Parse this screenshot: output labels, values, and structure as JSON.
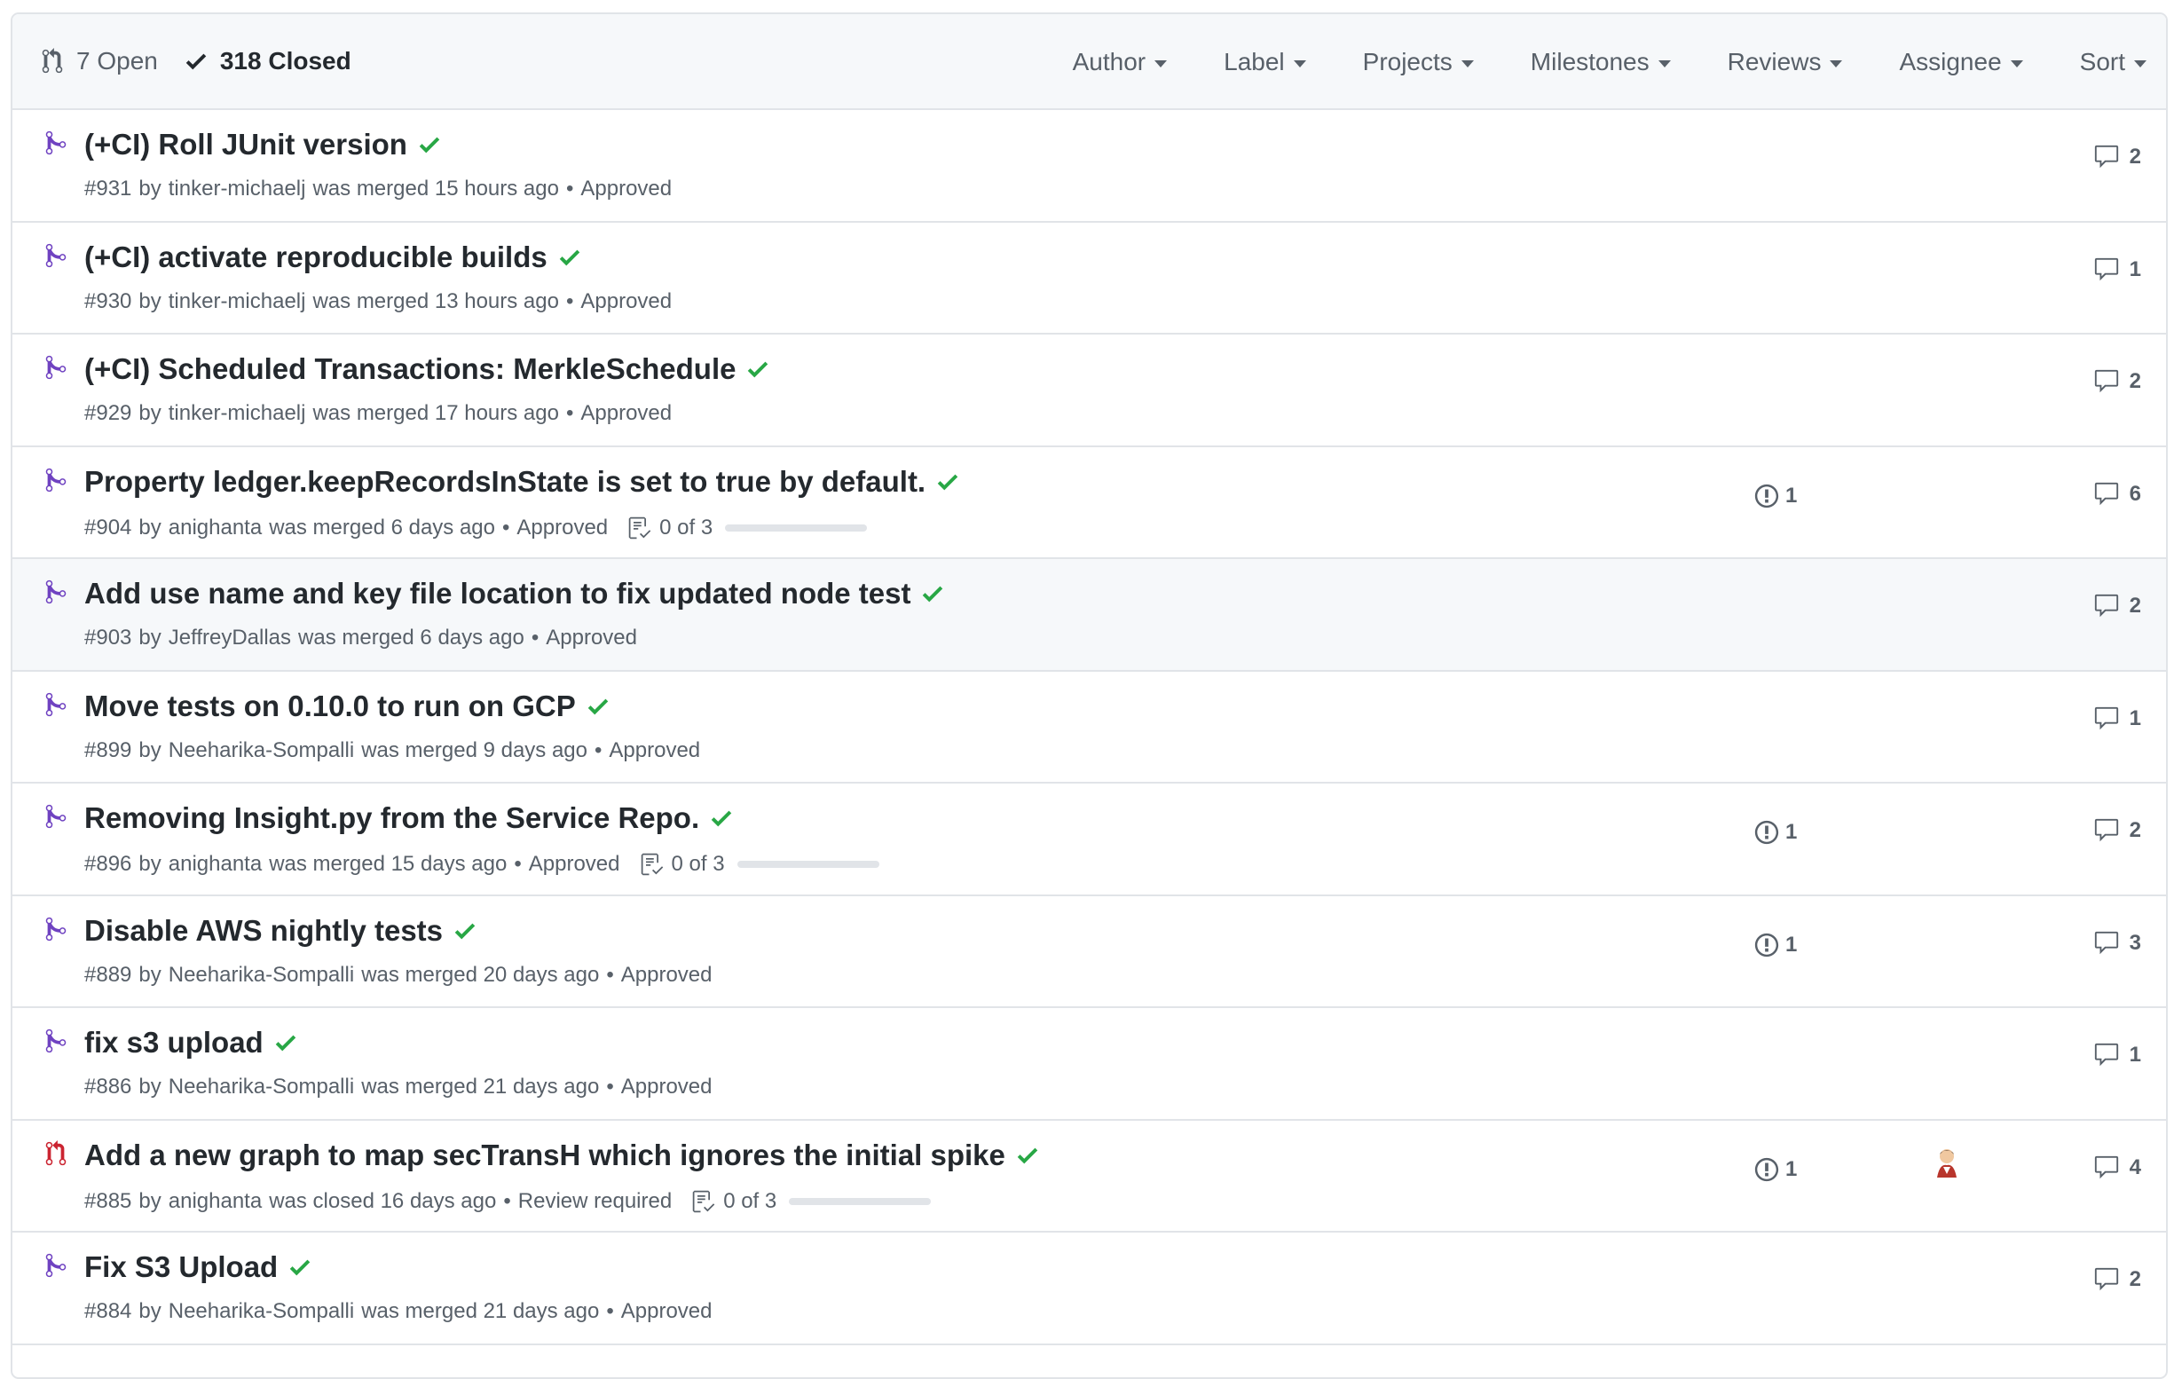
{
  "header": {
    "open_label": "7 Open",
    "closed_label": "318 Closed",
    "filters": [
      "Author",
      "Label",
      "Projects",
      "Milestones",
      "Reviews",
      "Assignee",
      "Sort"
    ]
  },
  "pull_requests": [
    {
      "title": "(+CI) Roll JUnit version",
      "number": "#931",
      "by": "by",
      "author": "tinker-michaelj",
      "action": "was merged 15 hours ago",
      "review": "Approved",
      "tasks": "",
      "linked_issues": "",
      "comments": "2",
      "state": "merged",
      "avatar": false
    },
    {
      "title": "(+CI) activate reproducible builds",
      "number": "#930",
      "by": "by",
      "author": "tinker-michaelj",
      "action": "was merged 13 hours ago",
      "review": "Approved",
      "tasks": "",
      "linked_issues": "",
      "comments": "1",
      "state": "merged",
      "avatar": false
    },
    {
      "title": "(+CI) Scheduled Transactions: MerkleSchedule",
      "number": "#929",
      "by": "by",
      "author": "tinker-michaelj",
      "action": "was merged 17 hours ago",
      "review": "Approved",
      "tasks": "",
      "linked_issues": "",
      "comments": "2",
      "state": "merged",
      "avatar": false
    },
    {
      "title": "Property ledger.keepRecordsInState is set to true by default.",
      "number": "#904",
      "by": "by",
      "author": "anighanta",
      "action": "was merged 6 days ago",
      "review": "Approved",
      "tasks": "0 of 3",
      "linked_issues": "1",
      "comments": "6",
      "state": "merged",
      "avatar": false
    },
    {
      "title": "Add use name and key file location to fix updated node test",
      "number": "#903",
      "by": "by",
      "author": "JeffreyDallas",
      "action": "was merged 6 days ago",
      "review": "Approved",
      "tasks": "",
      "linked_issues": "",
      "comments": "2",
      "state": "merged",
      "avatar": false
    },
    {
      "title": "Move tests on 0.10.0 to run on GCP",
      "number": "#899",
      "by": "by",
      "author": "Neeharika-Sompalli",
      "action": "was merged 9 days ago",
      "review": "Approved",
      "tasks": "",
      "linked_issues": "",
      "comments": "1",
      "state": "merged",
      "avatar": false
    },
    {
      "title": "Removing Insight.py from the Service Repo.",
      "number": "#896",
      "by": "by",
      "author": "anighanta",
      "action": "was merged 15 days ago",
      "review": "Approved",
      "tasks": "0 of 3",
      "linked_issues": "1",
      "comments": "2",
      "state": "merged",
      "avatar": false
    },
    {
      "title": "Disable AWS nightly tests",
      "number": "#889",
      "by": "by",
      "author": "Neeharika-Sompalli",
      "action": "was merged 20 days ago",
      "review": "Approved",
      "tasks": "",
      "linked_issues": "1",
      "comments": "3",
      "state": "merged",
      "avatar": false
    },
    {
      "title": "fix s3 upload",
      "number": "#886",
      "by": "by",
      "author": "Neeharika-Sompalli",
      "action": "was merged 21 days ago",
      "review": "Approved",
      "tasks": "",
      "linked_issues": "",
      "comments": "1",
      "state": "merged",
      "avatar": false
    },
    {
      "title": "Add a new graph to map secTransH which ignores the initial spike",
      "number": "#885",
      "by": "by",
      "author": "anighanta",
      "action": "was closed 16 days ago",
      "review": "Review required",
      "tasks": "0 of 3",
      "linked_issues": "1",
      "comments": "4",
      "state": "closed",
      "avatar": true
    },
    {
      "title": "Fix S3 Upload",
      "number": "#884",
      "by": "by",
      "author": "Neeharika-Sompalli",
      "action": "was merged 21 days ago",
      "review": "Approved",
      "tasks": "",
      "linked_issues": "",
      "comments": "2",
      "state": "merged",
      "avatar": false
    }
  ],
  "colors": {
    "merged": "#6f42c1",
    "closed": "#cb2431",
    "check": "#28a745",
    "muted": "#586069"
  }
}
